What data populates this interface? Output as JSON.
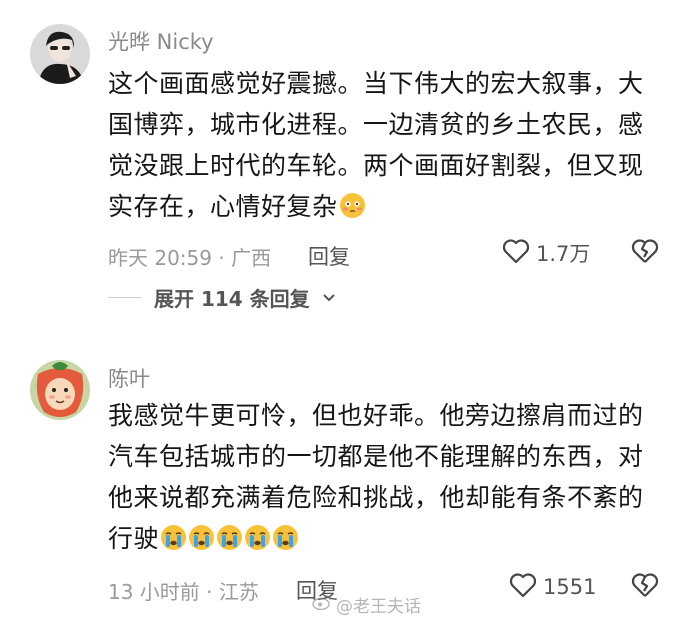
{
  "comments": [
    {
      "username": "光晔 Nicky",
      "text": "这个画面感觉好震撼。当下伟大的宏大叙事，大国博弈，城市化进程。一边清贫的乡土农民，感觉没跟上时代的车轮。两个画面好割裂，但又现实存在，心情好复杂",
      "emojis": [
        "flushed-face"
      ],
      "time_location": "昨天 20:59 · 广西",
      "reply_label": "回复",
      "like_count": "1.7万"
    },
    {
      "username": "陈叶",
      "text": "我感觉牛更可怜，但也好乖。他旁边擦肩而过的汽车包括城市的一切都是他不能理解的东西，对他来说都充满着危险和挑战，他却能有条不紊的行驶",
      "emojis": [
        "crying-face",
        "crying-face",
        "crying-face",
        "crying-face",
        "crying-face"
      ],
      "time_location": "13 小时前 · 江苏",
      "reply_label": "回复",
      "like_count": "1551"
    }
  ],
  "expand_replies": {
    "label": "展开 114 条回复"
  },
  "watermark": {
    "text": "@老王夫话"
  },
  "colors": {
    "text": "#161616",
    "meta": "#9a9a9a",
    "emoji": "#f7c23a",
    "tear": "#3aa3f0"
  }
}
